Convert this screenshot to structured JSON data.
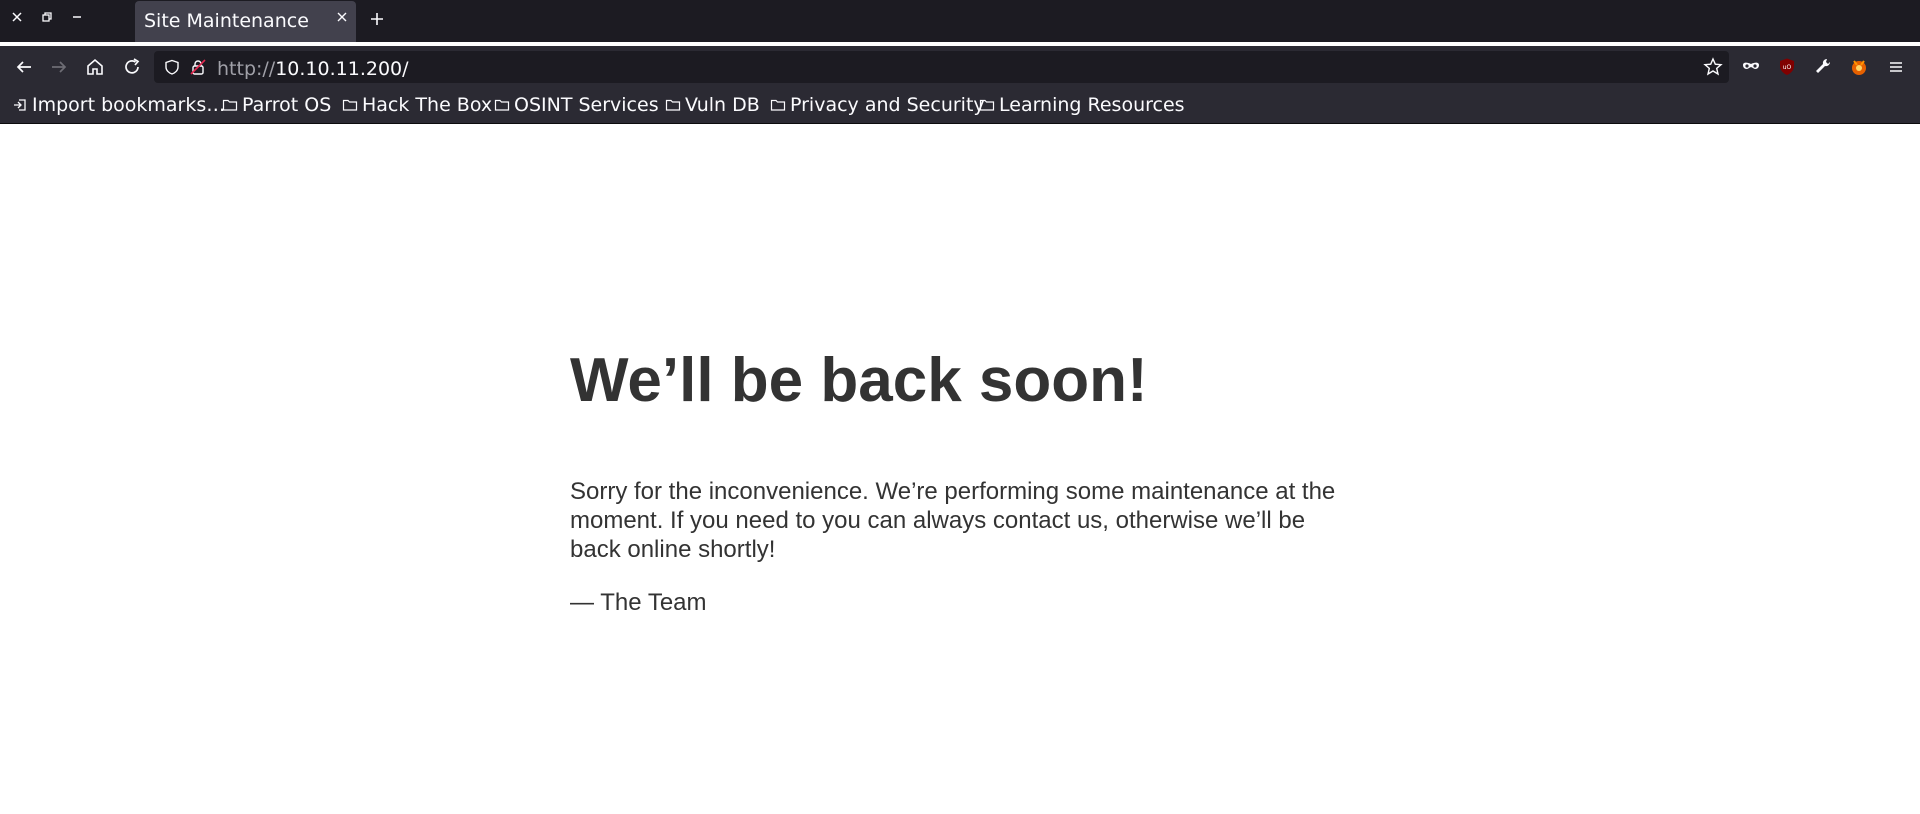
{
  "window": {
    "controls": [
      "close-icon",
      "restore-icon",
      "minimize-icon"
    ]
  },
  "tab": {
    "title": "Site Maintenance",
    "close_icon": "close-icon",
    "new_tab_icon": "plus-icon"
  },
  "toolbar": {
    "nav_icons": [
      "back-arrow-icon",
      "forward-arrow-icon",
      "home-icon",
      "reload-icon"
    ],
    "url_protocol": "http://",
    "url_host": "10.10.11.200/",
    "right_icons": [
      "star-icon",
      "private-mask-icon",
      "ublock-icon",
      "wrench-icon",
      "firefox-addon-icon",
      "menu-icon"
    ]
  },
  "bookmarks": {
    "items": [
      {
        "label": "Import bookmarks…",
        "icon": "import-icon"
      },
      {
        "label": "Parrot OS",
        "icon": "folder-icon"
      },
      {
        "label": "Hack The Box",
        "icon": "folder-icon"
      },
      {
        "label": "OSINT Services",
        "icon": "folder-icon"
      },
      {
        "label": "Vuln DB",
        "icon": "folder-icon"
      },
      {
        "label": "Privacy and Security",
        "icon": "folder-icon"
      },
      {
        "label": "Learning Resources",
        "icon": "folder-icon"
      }
    ]
  },
  "page": {
    "heading": "We’ll be back soon!",
    "message": "Sorry for the inconvenience. We’re performing some maintenance at the moment. If you need to you can always contact us, otherwise we’ll be back online shortly!",
    "signature": "— The Team"
  },
  "colors": {
    "titlebar_bg": "#1c1b22",
    "toolbar_bg": "#2b2a33",
    "tab_active_bg": "#42414d",
    "page_text": "#333333",
    "ublock_red": "#800000"
  }
}
